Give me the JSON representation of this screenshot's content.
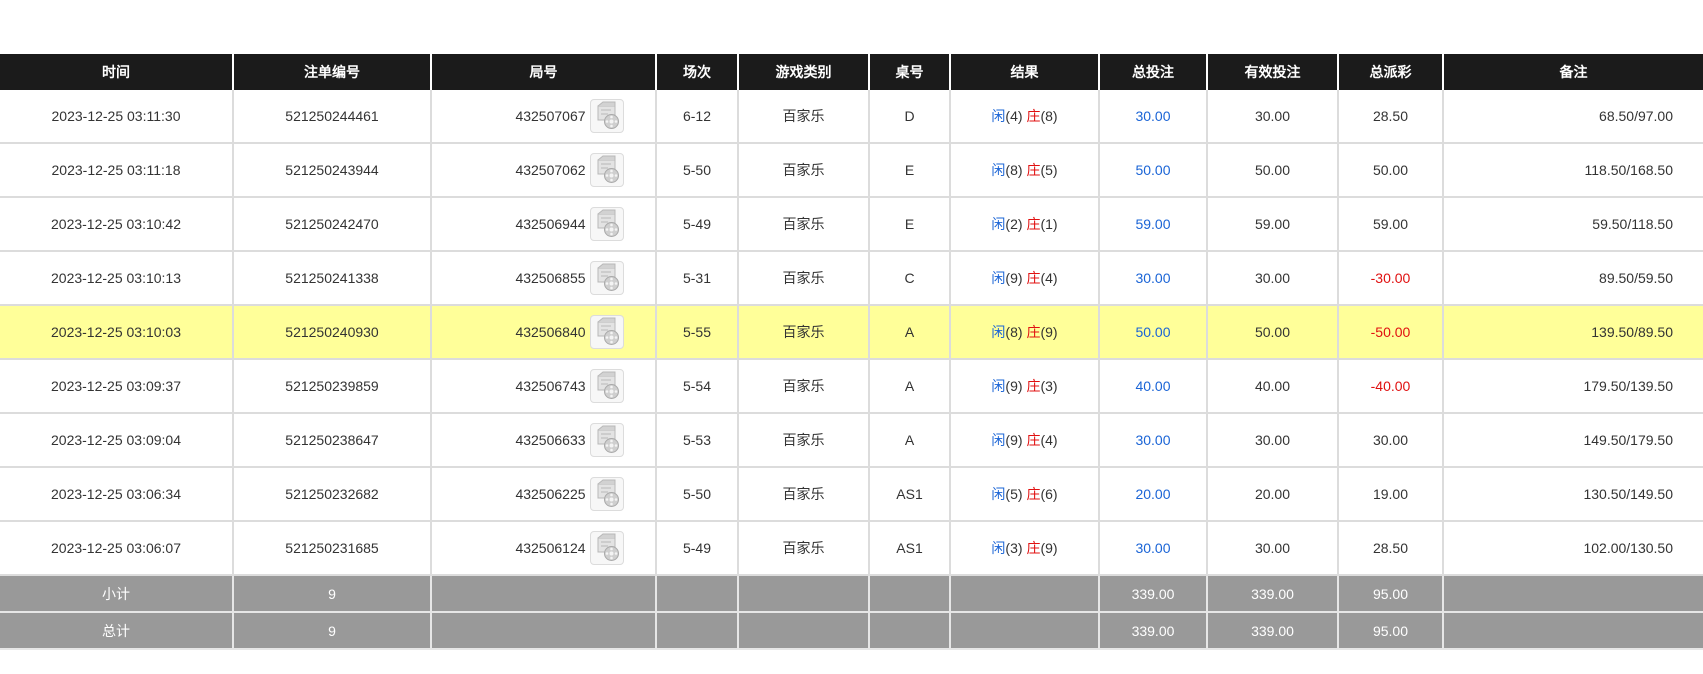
{
  "headers": [
    "时间",
    "注单编号",
    "局号",
    "场次",
    "游戏类别",
    "桌号",
    "结果",
    "总投注",
    "有效投注",
    "总派彩",
    "备注"
  ],
  "rows": [
    {
      "time": "2023-12-25 03:11:30",
      "bet_id": "521250244461",
      "round": "432507067",
      "session": "6-12",
      "game": "百家乐",
      "table": "D",
      "xian": "闲",
      "xian_score": "(4)",
      "zhuang": "庄",
      "zhuang_score": "(8)",
      "total_bet": "30.00",
      "valid_bet": "30.00",
      "payout": "28.50",
      "payout_negative": false,
      "remark": "68.50/97.00",
      "highlight": false
    },
    {
      "time": "2023-12-25 03:11:18",
      "bet_id": "521250243944",
      "round": "432507062",
      "session": "5-50",
      "game": "百家乐",
      "table": "E",
      "xian": "闲",
      "xian_score": "(8)",
      "zhuang": "庄",
      "zhuang_score": "(5)",
      "total_bet": "50.00",
      "valid_bet": "50.00",
      "payout": "50.00",
      "payout_negative": false,
      "remark": "118.50/168.50",
      "highlight": false
    },
    {
      "time": "2023-12-25 03:10:42",
      "bet_id": "521250242470",
      "round": "432506944",
      "session": "5-49",
      "game": "百家乐",
      "table": "E",
      "xian": "闲",
      "xian_score": "(2)",
      "zhuang": "庄",
      "zhuang_score": "(1)",
      "total_bet": "59.00",
      "valid_bet": "59.00",
      "payout": "59.00",
      "payout_negative": false,
      "remark": "59.50/118.50",
      "highlight": false
    },
    {
      "time": "2023-12-25 03:10:13",
      "bet_id": "521250241338",
      "round": "432506855",
      "session": "5-31",
      "game": "百家乐",
      "table": "C",
      "xian": "闲",
      "xian_score": "(9)",
      "zhuang": "庄",
      "zhuang_score": "(4)",
      "total_bet": "30.00",
      "valid_bet": "30.00",
      "payout": "-30.00",
      "payout_negative": true,
      "remark": "89.50/59.50",
      "highlight": false
    },
    {
      "time": "2023-12-25 03:10:03",
      "bet_id": "521250240930",
      "round": "432506840",
      "session": "5-55",
      "game": "百家乐",
      "table": "A",
      "xian": "闲",
      "xian_score": "(8)",
      "zhuang": "庄",
      "zhuang_score": "(9)",
      "total_bet": "50.00",
      "valid_bet": "50.00",
      "payout": "-50.00",
      "payout_negative": true,
      "remark": "139.50/89.50",
      "highlight": true
    },
    {
      "time": "2023-12-25 03:09:37",
      "bet_id": "521250239859",
      "round": "432506743",
      "session": "5-54",
      "game": "百家乐",
      "table": "A",
      "xian": "闲",
      "xian_score": "(9)",
      "zhuang": "庄",
      "zhuang_score": "(3)",
      "total_bet": "40.00",
      "valid_bet": "40.00",
      "payout": "-40.00",
      "payout_negative": true,
      "remark": "179.50/139.50",
      "highlight": false
    },
    {
      "time": "2023-12-25 03:09:04",
      "bet_id": "521250238647",
      "round": "432506633",
      "session": "5-53",
      "game": "百家乐",
      "table": "A",
      "xian": "闲",
      "xian_score": "(9)",
      "zhuang": "庄",
      "zhuang_score": "(4)",
      "total_bet": "30.00",
      "valid_bet": "30.00",
      "payout": "30.00",
      "payout_negative": false,
      "remark": "149.50/179.50",
      "highlight": false
    },
    {
      "time": "2023-12-25 03:06:34",
      "bet_id": "521250232682",
      "round": "432506225",
      "session": "5-50",
      "game": "百家乐",
      "table": "AS1",
      "xian": "闲",
      "xian_score": "(5)",
      "zhuang": "庄",
      "zhuang_score": "(6)",
      "total_bet": "20.00",
      "valid_bet": "20.00",
      "payout": "19.00",
      "payout_negative": false,
      "remark": "130.50/149.50",
      "highlight": false
    },
    {
      "time": "2023-12-25 03:06:07",
      "bet_id": "521250231685",
      "round": "432506124",
      "session": "5-49",
      "game": "百家乐",
      "table": "AS1",
      "xian": "闲",
      "xian_score": "(3)",
      "zhuang": "庄",
      "zhuang_score": "(9)",
      "total_bet": "30.00",
      "valid_bet": "30.00",
      "payout": "28.50",
      "payout_negative": false,
      "remark": "102.00/130.50",
      "highlight": false
    }
  ],
  "subtotal": {
    "label": "小计",
    "count": "9",
    "total_bet": "339.00",
    "valid_bet": "339.00",
    "payout": "95.00"
  },
  "grand_total": {
    "label": "总计",
    "count": "9",
    "total_bet": "339.00",
    "valid_bet": "339.00",
    "payout": "95.00"
  },
  "video_icon": "video-replay-icon",
  "colors": {
    "header_bg": "#1b1b1b",
    "highlight_row": "#ffff99",
    "summary_bg": "#999999",
    "bet_blue": "#1a64d6",
    "negative_red": "#e01010"
  }
}
